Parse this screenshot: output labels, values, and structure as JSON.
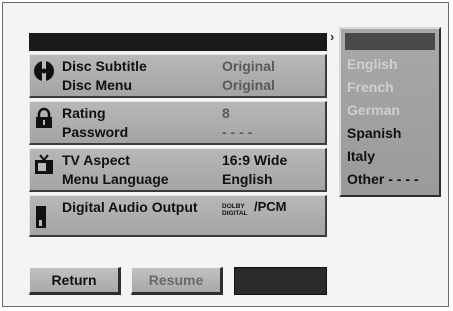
{
  "menu": {
    "rows": [
      {
        "icon": "disc-icon",
        "items": [
          {
            "label": "Disc Subtitle",
            "value": "Original"
          },
          {
            "label": "Disc Menu",
            "value": "Original"
          }
        ]
      },
      {
        "icon": "lock-icon",
        "items": [
          {
            "label": "Rating",
            "value": "8"
          },
          {
            "label": "Password",
            "value": "- - - -"
          }
        ]
      },
      {
        "icon": "tv-icon",
        "items": [
          {
            "label": "TV Aspect",
            "value": "16:9 Wide"
          },
          {
            "label": "Menu Language",
            "value": "English"
          }
        ]
      },
      {
        "icon": "audio-icon",
        "items": [
          {
            "label": "Digital Audio Output",
            "value_logo_line1": "DOLBY",
            "value_logo_line2": "DIGITAL",
            "value": "/PCM"
          }
        ]
      }
    ]
  },
  "language_panel": {
    "options": [
      "English",
      "French",
      "German",
      "Spanish",
      "Italy",
      "Other - - - -"
    ]
  },
  "buttons": {
    "return_label": "Return",
    "resume_label": "Resume"
  },
  "colors": {
    "menu_bar": "#1a1a1a",
    "row_gray": "#afafaf",
    "panel_gray": "#a2a2a2",
    "dim_text": "#cfcfcf"
  }
}
